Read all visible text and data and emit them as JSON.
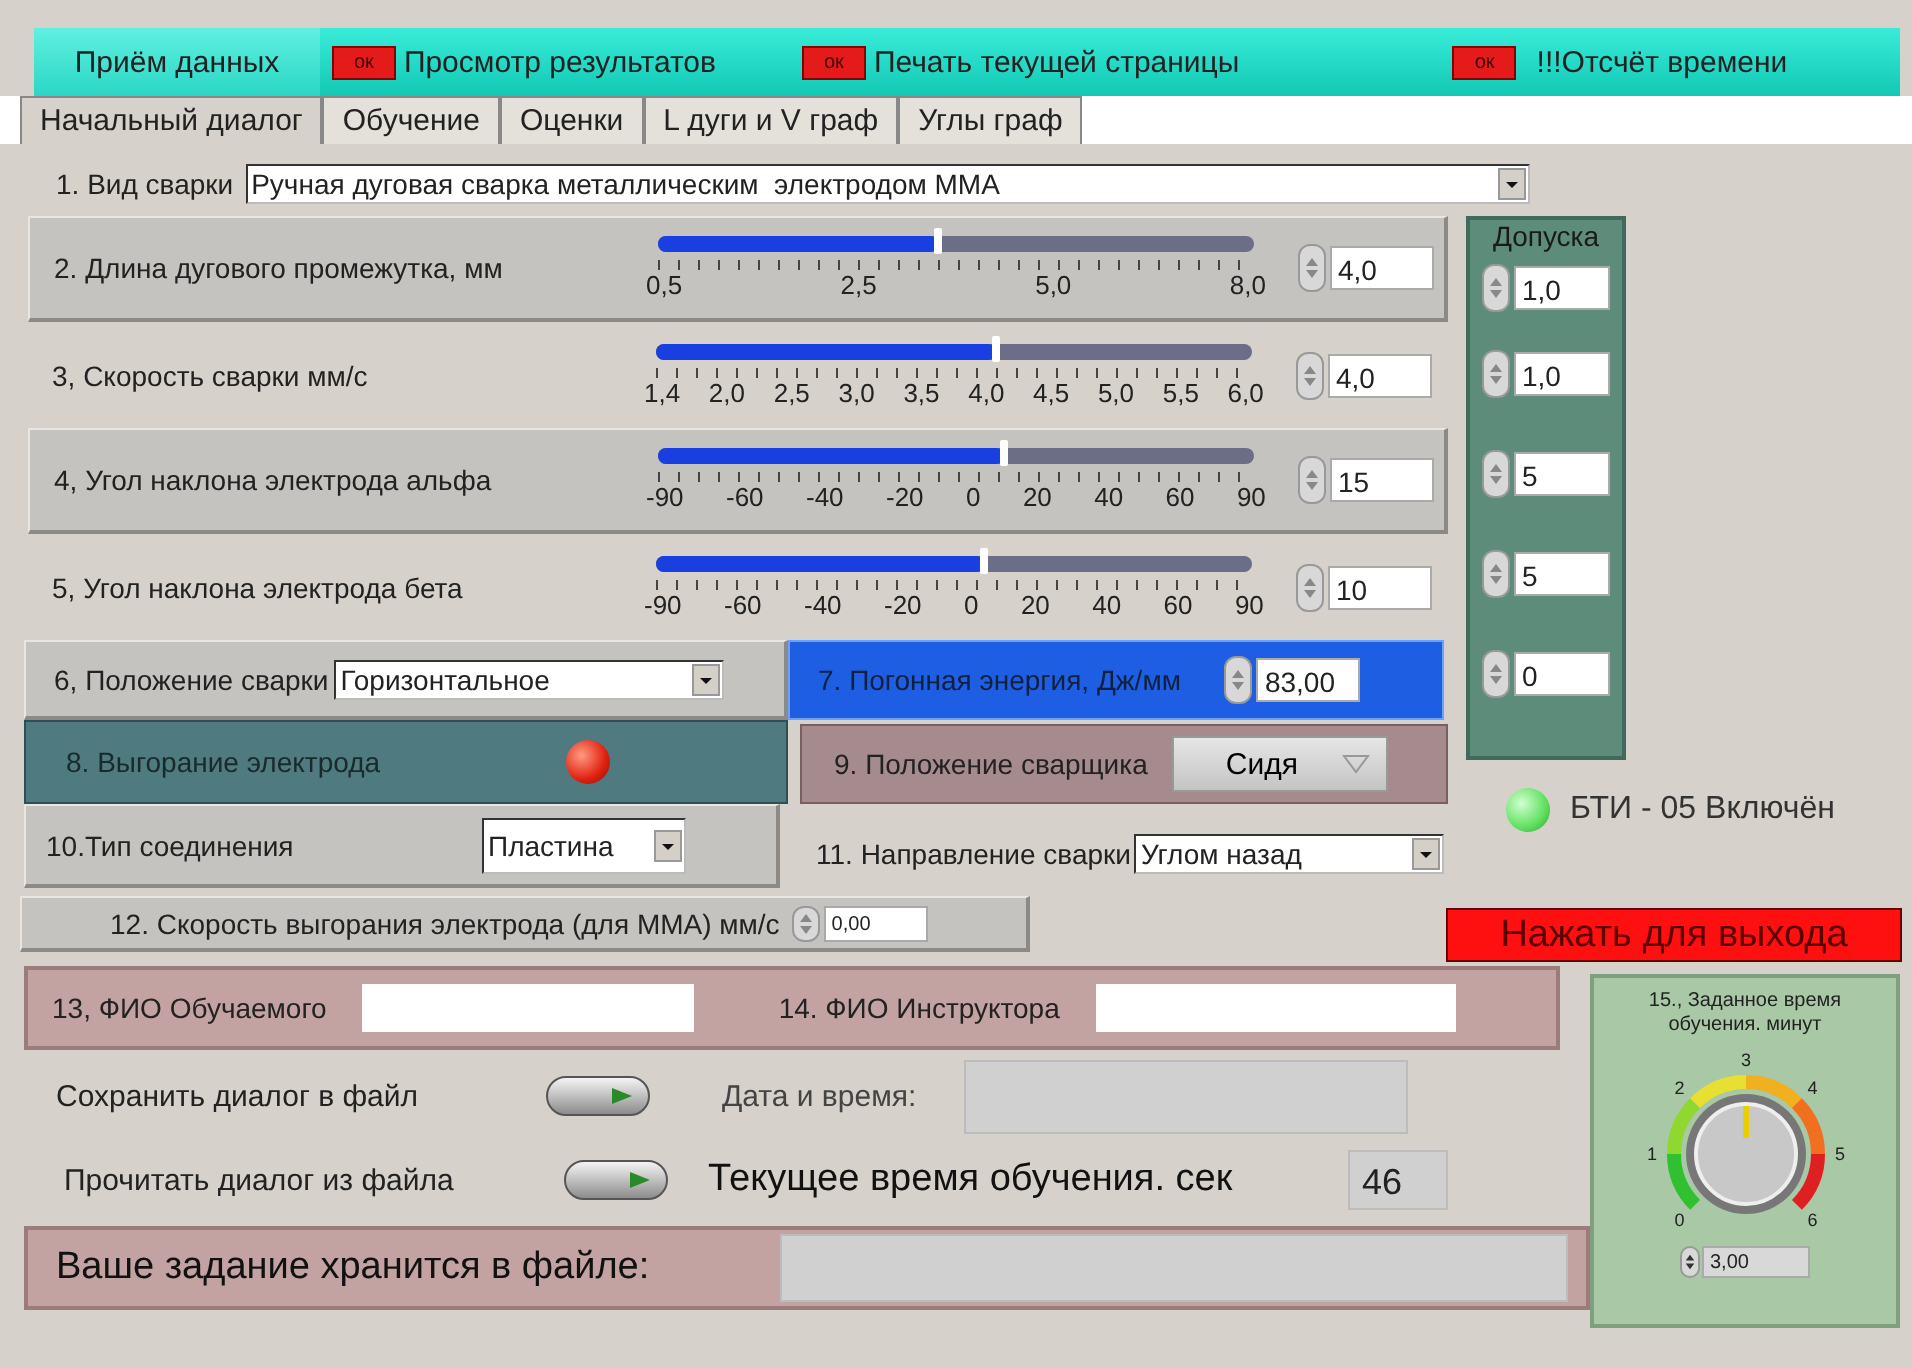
{
  "top_buttons": [
    {
      "label": "Приём данных"
    },
    {
      "label": "Просмотр результатов",
      "ok_label": "ок"
    },
    {
      "label": "Печать текущей страницы",
      "ok_label": "ок"
    },
    {
      "label": "!!!Отсчёт времени",
      "ok_label": "ок"
    }
  ],
  "tabs": [
    {
      "label": "Начальный диалог",
      "selected": true
    },
    {
      "label": "Обучение",
      "selected": false
    },
    {
      "label": "Оценки",
      "selected": false
    },
    {
      "label": "L дуги и V граф",
      "selected": false
    },
    {
      "label": "Углы граф",
      "selected": false
    }
  ],
  "weld_type": {
    "label": "1. Вид сварки",
    "value": "Ручная дуговая сварка металлическим  электродом ММА"
  },
  "sliders": [
    {
      "label": "2. Длина дугового промежутка, мм",
      "panel": true,
      "level": 0.47,
      "scale": [
        "0,5",
        "2,5",
        "5,0",
        "8,0"
      ],
      "value": "4,0"
    },
    {
      "label": "3, Скорость сварки мм/с",
      "panel": false,
      "level": 0.57,
      "scale": [
        "1,4",
        "2,0",
        "2,5",
        "3,0",
        "3,5",
        "4,0",
        "4,5",
        "5,0",
        "5,5",
        "6,0"
      ],
      "value": "4,0"
    },
    {
      "label": "4, Угол наклона электрода альфа",
      "panel": true,
      "level": 0.58,
      "scale": [
        "-90",
        "-60",
        "-40",
        "-20",
        "0",
        "20",
        "40",
        "60",
        "90"
      ],
      "value": "15"
    },
    {
      "label": "5, Угол наклона электрода бета",
      "panel": false,
      "level": 0.55,
      "scale": [
        "-90",
        "-60",
        "-40",
        "-20",
        "0",
        "20",
        "40",
        "60",
        "90"
      ],
      "value": "10"
    }
  ],
  "tolerances": {
    "title": "Допуска",
    "values": [
      "1,0",
      "1,0",
      "5",
      "5",
      "0"
    ]
  },
  "position": {
    "label": "6, Положение сварки",
    "value": "Горизонтальное"
  },
  "energy": {
    "label": "7. Погонная энергия, Дж/мм",
    "value": "83,00"
  },
  "burnout": {
    "label": "8. Выгорание электрода",
    "on": true
  },
  "welder_position": {
    "label": "9. Положение сварщика",
    "value": "Сидя"
  },
  "device": {
    "label": "БТИ - 05 Включён",
    "on": true
  },
  "joint_type": {
    "label": "10.Тип соединения",
    "value": "Пластина"
  },
  "direction": {
    "label": "11. Направление сварки",
    "value": "Углом назад"
  },
  "burn_rate": {
    "label": "12. Скорость выгорания электрода (для ММА) мм/с",
    "value": "0,00"
  },
  "exit_button": "Нажать для выхода",
  "trainee": {
    "label": "13, ФИО Обучаемого"
  },
  "instructor": {
    "label": "14. ФИО Инструктора"
  },
  "save": {
    "label": "Сохранить диалог в файл"
  },
  "datetime": {
    "label": "Дата и время:"
  },
  "load": {
    "label": "Прочитать диалог из файла"
  },
  "current_time": {
    "label": "Текущее время обучения. сек",
    "value": "46"
  },
  "file": {
    "label": "Ваше задание хранится в файле:"
  },
  "knob": {
    "title": "15., Заданное время обучения. минут",
    "scale": [
      "0",
      "1",
      "2",
      "3",
      "4",
      "5",
      "6"
    ],
    "level": 0.5,
    "value": "3,00"
  }
}
